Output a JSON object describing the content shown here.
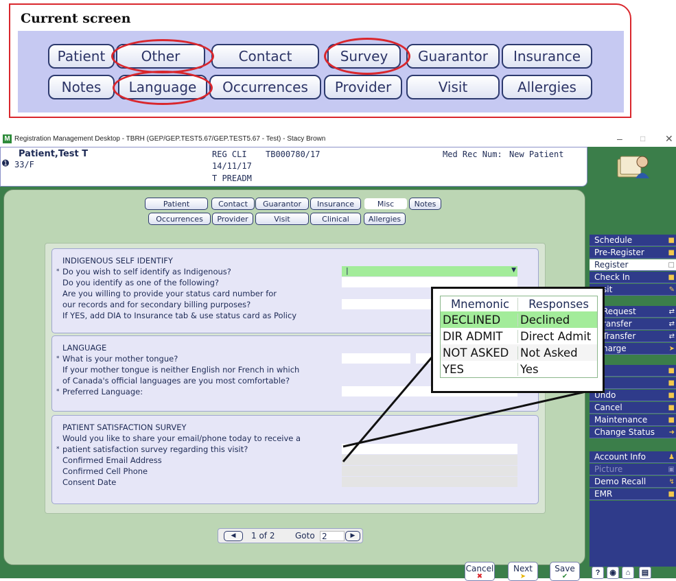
{
  "annotation": {
    "title": "Current screen",
    "row1": [
      "Patient",
      "Other",
      "Contact",
      "Survey",
      "Guarantor",
      "Insurance"
    ],
    "row2": [
      "Notes",
      "Language",
      "Occurrences",
      "Provider",
      "Visit",
      "Allergies"
    ],
    "highlight_color": "#d9262c"
  },
  "window": {
    "title": "Registration Management Desktop - TBRH (GEP/GEP.TEST5.67/GEP.TEST5.67 - Test) - Stacy Brown",
    "logo": "M",
    "controls": [
      "–",
      "□",
      "✕"
    ]
  },
  "patient": {
    "name": "Patient,Test T",
    "age_sex": "33/F",
    "reg_type": "REG CLI",
    "account": "TB000780/17",
    "date": "14/11/17",
    "status": "T PREADM",
    "med_rec_label": "Med Rec Num:",
    "med_rec_value": "New Patient",
    "info_icon": "info-icon"
  },
  "tabs": {
    "row1": [
      "Patient",
      "Contact",
      "Guarantor",
      "Insurance",
      "Misc",
      "Notes"
    ],
    "row2": [
      "Occurrences",
      "Provider",
      "Visit",
      "Clinical",
      "Allergies"
    ],
    "active": "Misc"
  },
  "sections": {
    "indigenous": {
      "heading": "INDIGENOUS SELF IDENTIFY",
      "q1": "Do you wish to self identify as Indigenous?",
      "q1_value": "|",
      "q2": "Do you identify as one of the following?",
      "q3a": "Are you willing to provide your status card number for",
      "q3b": "our records and for secondary billing purposes?",
      "q4": "If YES, add DIA to Insurance tab & use status card as Policy"
    },
    "language": {
      "heading": "LANGUAGE",
      "q1": "What is your mother tongue?",
      "q2a": "If your mother tongue is neither English nor French in which",
      "q2b": "of Canada's official languages are you most comfortable?",
      "q3": "Preferred Language:"
    },
    "survey": {
      "heading": "PATIENT SATISFACTION SURVEY",
      "q1a": "Would you like to share your email/phone today to receive a",
      "q1b": "patient satisfaction survey regarding this visit?",
      "email": "Confirmed Email Address",
      "phone": "Confirmed Cell Phone",
      "consent": "Consent Date"
    },
    "required_mark": "*"
  },
  "pager": {
    "prev": "◀",
    "page": "1 of 2",
    "goto_label": "Goto",
    "goto_value": "2",
    "next": "▶"
  },
  "actions": [
    {
      "label": "Schedule",
      "style": "dark"
    },
    {
      "label": "Pre-Register",
      "style": "dark"
    },
    {
      "label": "Register",
      "style": "light"
    },
    {
      "label": "Check In",
      "style": "dark"
    },
    {
      "label": "sit",
      "style": "dark"
    },
    {
      "label": "Request",
      "style": "dark"
    },
    {
      "label": "ransfer",
      "style": "dark"
    },
    {
      "label": "Transfer",
      "style": "dark"
    },
    {
      "label": "harge",
      "style": "dark"
    },
    {
      "label": "",
      "style": "dark"
    },
    {
      "label": "",
      "style": "dark"
    },
    {
      "label": "Undo",
      "style": "dark"
    },
    {
      "label": "Cancel",
      "style": "dark"
    },
    {
      "label": "Maintenance",
      "style": "dark"
    },
    {
      "label": "Change Status",
      "style": "dark"
    },
    {
      "label": "Account Info",
      "style": "dark"
    },
    {
      "label": "Picture",
      "style": "disabled"
    },
    {
      "label": "Demo Recall",
      "style": "dark"
    },
    {
      "label": "EMR",
      "style": "dark"
    }
  ],
  "bottom": {
    "cancel": "Cancel",
    "next": "Next",
    "save": "Save",
    "help": "?",
    "icons": [
      "globe-icon",
      "home-icon",
      "card-icon"
    ]
  },
  "callout": {
    "headers": [
      "Mnemonic",
      "Responses"
    ],
    "rows": [
      [
        "DECLINED",
        "Declined"
      ],
      [
        "DIR ADMIT",
        "Direct Admit"
      ],
      [
        "NOT ASKED",
        "Not Asked"
      ],
      [
        "YES",
        "Yes"
      ]
    ],
    "selected_row": 0
  },
  "colors": {
    "app_green": "#3b7e4a",
    "panel_green": "#bcd6b4",
    "action_blue": "#2f3b8a",
    "field_green": "#a3ec9a"
  }
}
